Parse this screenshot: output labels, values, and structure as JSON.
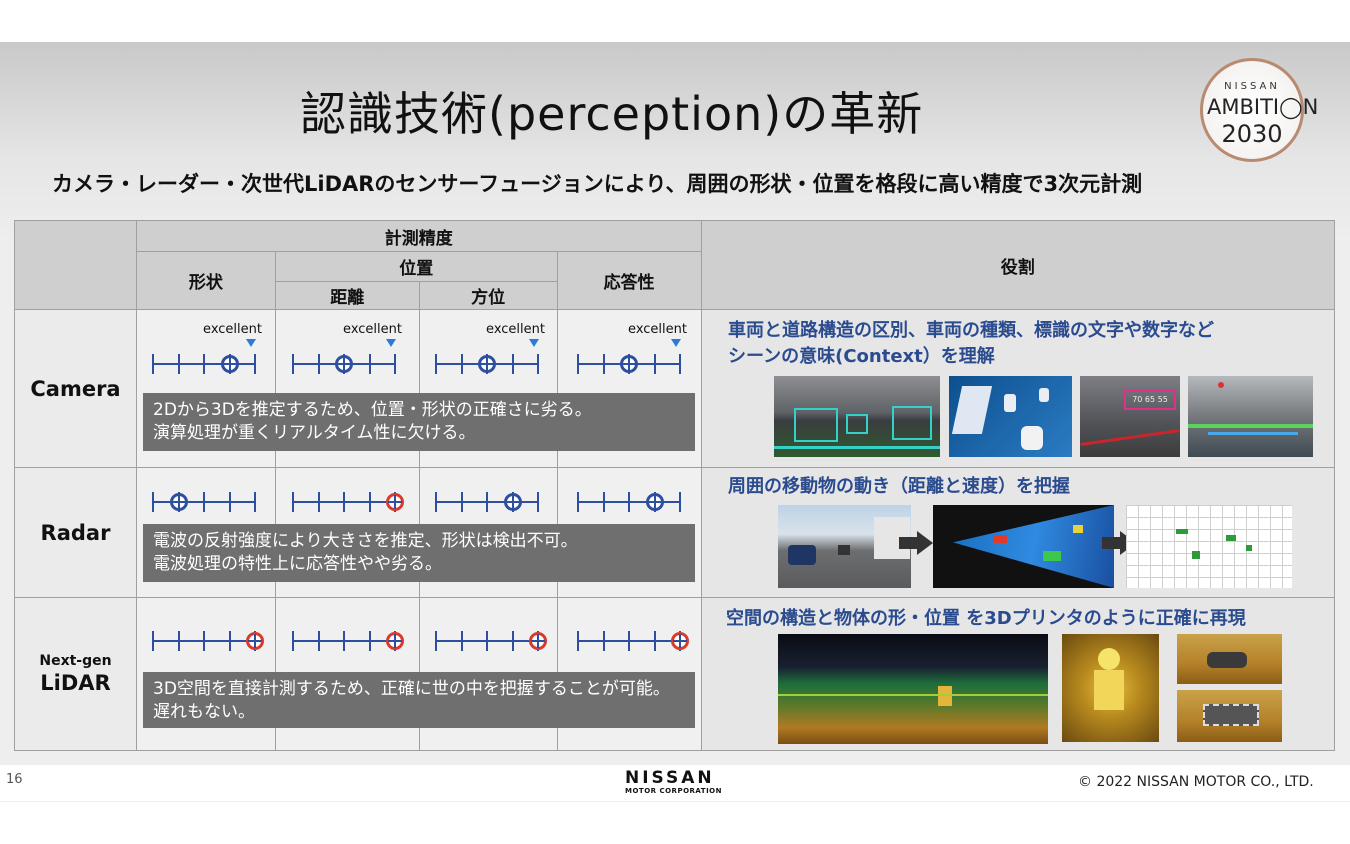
{
  "title": "認識技術(perception)の革新",
  "subtitle": "カメラ・レーダー・次世代LiDARのセンサーフュージョンにより、周囲の形状・位置を格段に高い精度で3次元計測",
  "logo": {
    "line1": "NISSAN",
    "line2": "AMBITI◯N",
    "line3": "2030"
  },
  "header": {
    "accuracy": "計測精度",
    "shape": "形状",
    "position": "位置",
    "distance": "距離",
    "direction": "方位",
    "response": "応答性",
    "role": "役割"
  },
  "gauge_label": "excellent",
  "rows": [
    {
      "name": "Camera",
      "small": "",
      "note1": "2Dから3Dを推定するため、位置・形状の正確さに劣る。",
      "note2": "演算処理が重くリアルタイム性に欠ける。",
      "role1": "車両と道路構造の区別、車両の種類、標識の文字や数字など",
      "role2": "シーンの意味(Context）を理解",
      "levels": [
        3,
        2,
        2,
        2
      ],
      "excellent_markers": true
    },
    {
      "name": "Radar",
      "small": "",
      "note1": "電波の反射強度により大きさを推定、形状は検出不可。",
      "note2": "電波処理の特性上に応答性やや劣る。",
      "role1": "周囲の移動物の動き（距離と速度）を把握",
      "role2": "",
      "levels": [
        1,
        4,
        3,
        3
      ],
      "red": [
        false,
        true,
        false,
        false
      ]
    },
    {
      "name": "LiDAR",
      "small": "Next-gen",
      "note1": "3D空間を直接計測するため、正確に世の中を把握することが可能。",
      "note2": "遅れもない。",
      "role1": "空間の構造と物体の形・位置 を3Dプリンタのように正確に再現",
      "role2": "",
      "levels": [
        4,
        4,
        4,
        4
      ],
      "red": [
        true,
        true,
        true,
        true
      ]
    }
  ],
  "images": {
    "sign_numbers": "70 65 55"
  },
  "footer": {
    "page": "16",
    "brand": "NISSAN",
    "brand_sub": "MOTOR CORPORATION",
    "copyright": "© 2022 NISSAN MOTOR CO., LTD."
  },
  "colors": {
    "role_text": "#2b4b8f",
    "gauge": "#2e4fa0",
    "red_marker": "#d83a2c",
    "note_bg": "#6f6f6f"
  }
}
